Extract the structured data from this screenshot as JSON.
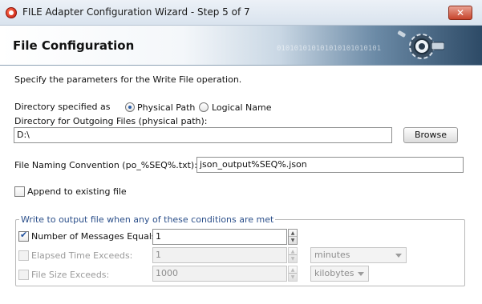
{
  "window": {
    "title": "FILE Adapter Configuration Wizard - Step 5 of 7",
    "close_label": "✕"
  },
  "banner": {
    "title": "File Configuration",
    "binary_text": "010101010101010101010101"
  },
  "instruction": "Specify the parameters for the Write File operation.",
  "directory": {
    "label": "Directory specified as",
    "physical_path_label": "Physical Path",
    "logical_name_label": "Logical Name",
    "selected": "Physical Path",
    "outgoing_label": "Directory for Outgoing Files (physical path):",
    "value": "D:\\",
    "browse_label": "Browse"
  },
  "file_naming": {
    "label": "File Naming Convention (po_%SEQ%.txt):",
    "value": "json_output%SEQ%.json"
  },
  "append": {
    "label": "Append to existing file",
    "checked": false
  },
  "conditions": {
    "legend": "Write to output file when any of these conditions are met",
    "number_of_messages": {
      "label": "Number of Messages Equals:",
      "checked": true,
      "value": "1"
    },
    "elapsed_time": {
      "label": "Elapsed Time Exceeds:",
      "checked": false,
      "value": "1",
      "unit": "minutes"
    },
    "file_size": {
      "label": "File Size Exceeds:",
      "checked": false,
      "value": "1000",
      "unit": "kilobytes"
    }
  }
}
